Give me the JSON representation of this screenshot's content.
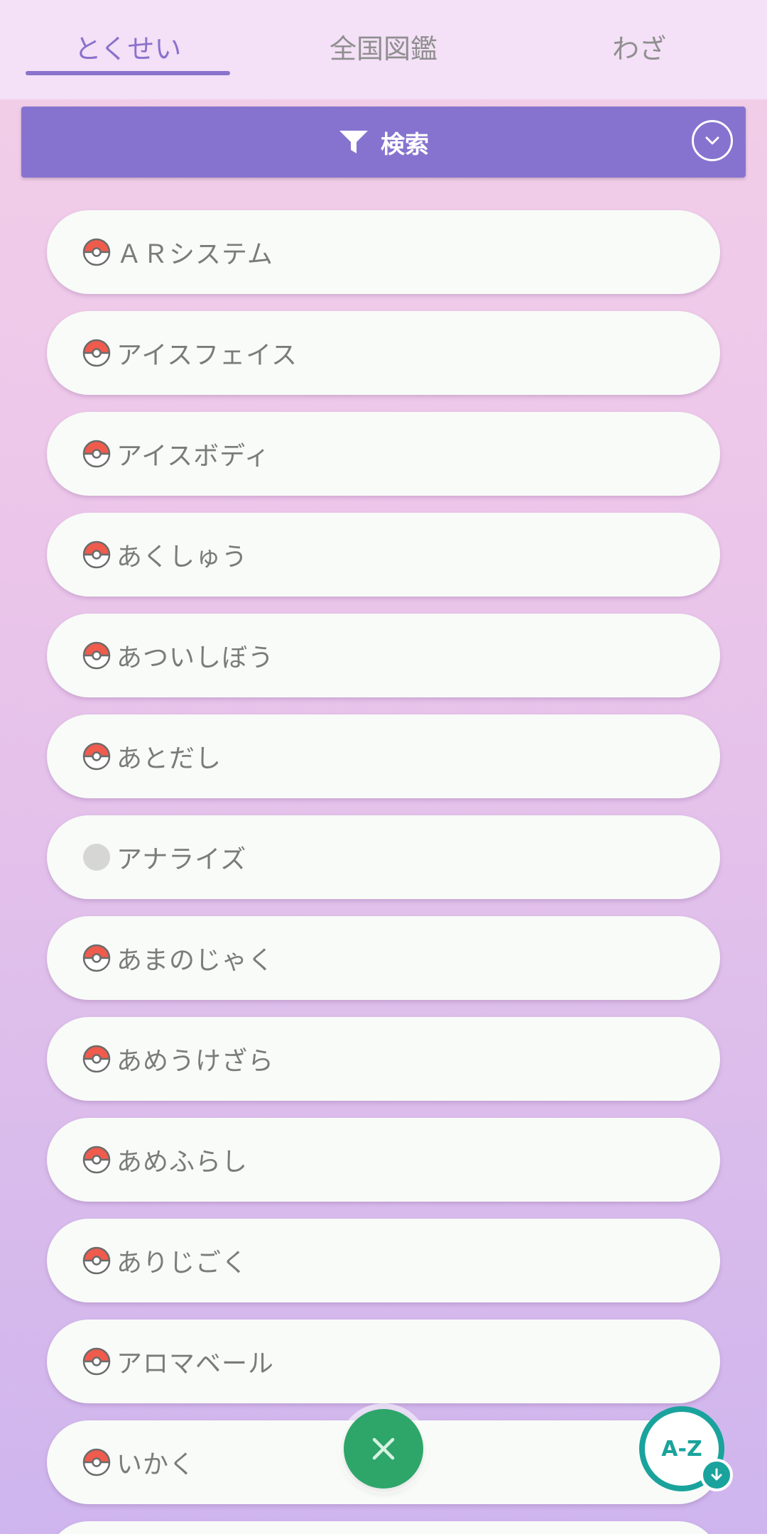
{
  "tabs": [
    {
      "label": "とくせい",
      "active": true
    },
    {
      "label": "全国図鑑",
      "active": false
    },
    {
      "label": "わざ",
      "active": false
    }
  ],
  "search": {
    "label": "検索",
    "filter_icon": "filter-icon",
    "expand_icon": "chevron-down-icon"
  },
  "abilities": [
    {
      "name": "ＡＲシステム",
      "icon": "pokeball-icon"
    },
    {
      "name": "アイスフェイス",
      "icon": "pokeball-icon"
    },
    {
      "name": "アイスボディ",
      "icon": "pokeball-icon"
    },
    {
      "name": "あくしゅう",
      "icon": "pokeball-icon"
    },
    {
      "name": "あついしぼう",
      "icon": "pokeball-icon"
    },
    {
      "name": "あとだし",
      "icon": "pokeball-icon"
    },
    {
      "name": "アナライズ",
      "icon": "gray-circle-icon"
    },
    {
      "name": "あまのじゃく",
      "icon": "pokeball-icon"
    },
    {
      "name": "あめうけざら",
      "icon": "pokeball-icon"
    },
    {
      "name": "あめふらし",
      "icon": "pokeball-icon"
    },
    {
      "name": "ありじごく",
      "icon": "pokeball-icon"
    },
    {
      "name": "アロマベール",
      "icon": "pokeball-icon"
    },
    {
      "name": "いかく",
      "icon": "pokeball-icon"
    },
    {
      "name": "",
      "icon": ""
    }
  ],
  "fab": {
    "close_icon": "close-icon",
    "sort_label": "A-Z",
    "sort_badge_icon": "arrow-down-icon"
  },
  "colors": {
    "accent": "#8673cf",
    "fab_green": "#2ea66a",
    "fab_teal": "#1aa39c",
    "pokeball_red": "#ef5b4c"
  }
}
